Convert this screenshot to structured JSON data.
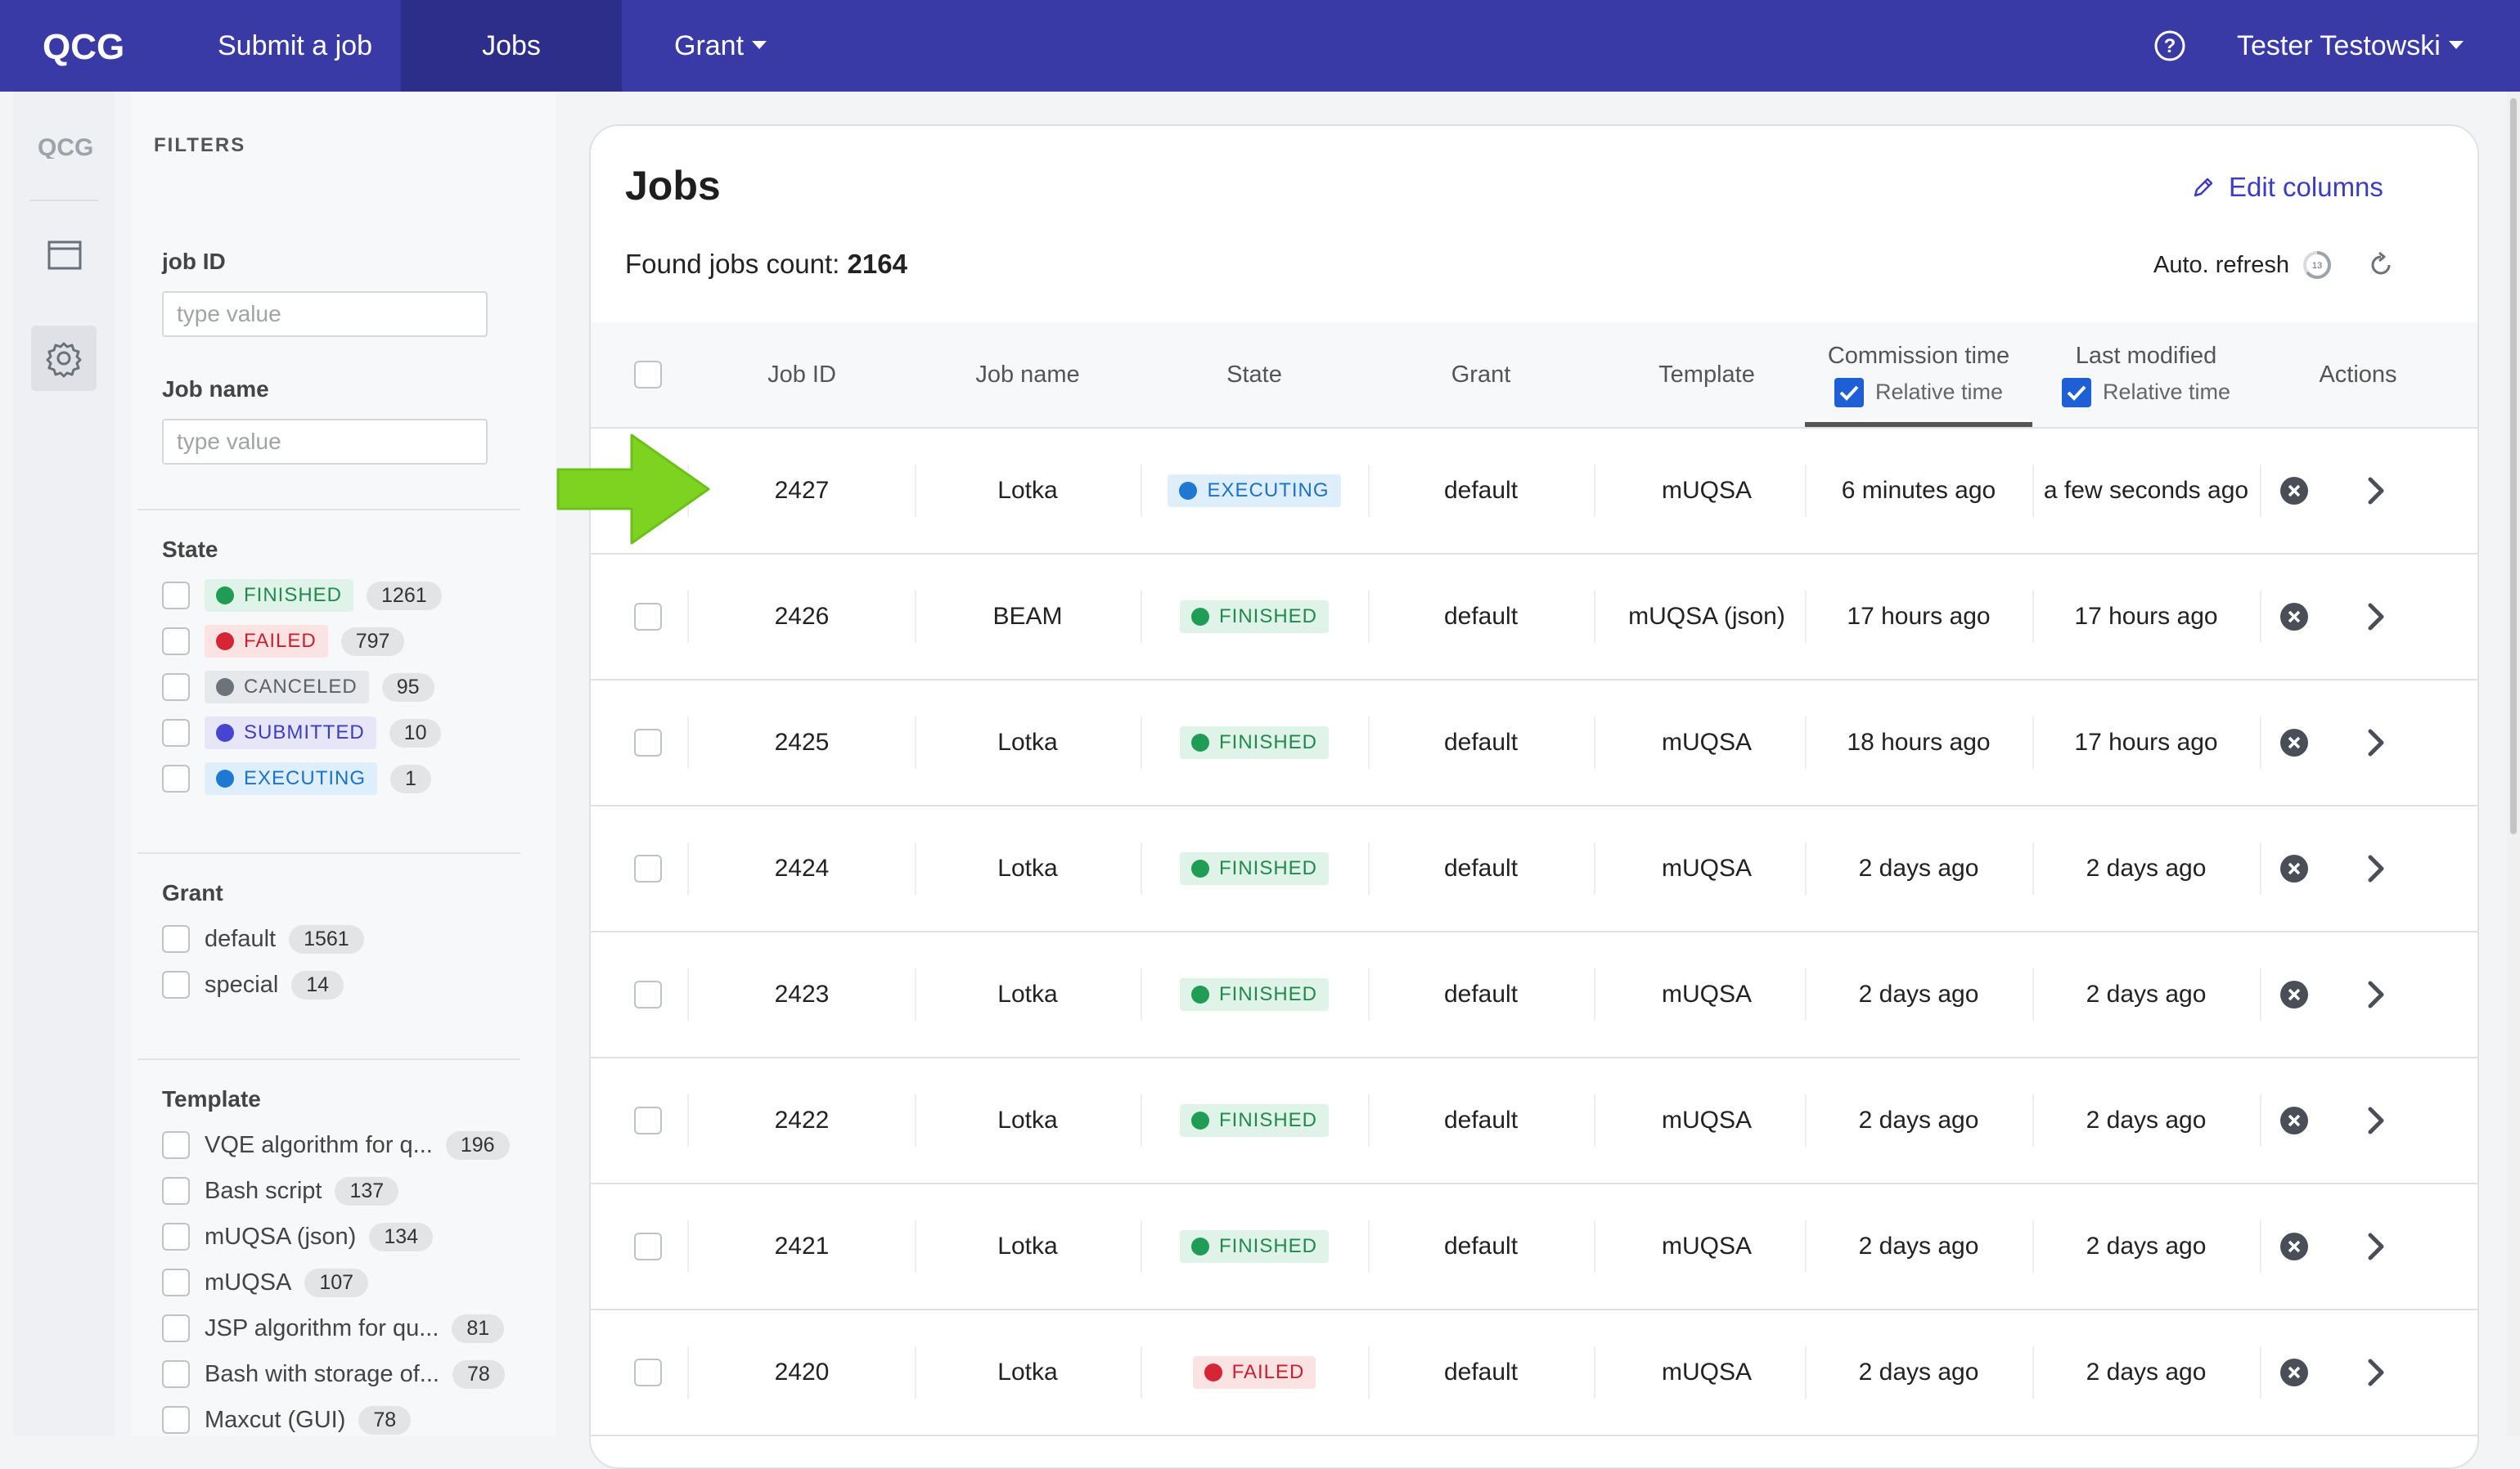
{
  "nav": {
    "logo": "QCG",
    "items": [
      "Submit a job",
      "Jobs",
      "Grant"
    ],
    "user": "Tester Testowski"
  },
  "rail": {
    "logo": "QCG",
    "icons": [
      "folder-icon",
      "gear-icon"
    ]
  },
  "filters": {
    "title": "FILTERS",
    "job_id": {
      "label": "job ID",
      "placeholder": "type value"
    },
    "job_name": {
      "label": "Job name",
      "placeholder": "type value"
    },
    "state": {
      "label": "State",
      "items": [
        {
          "label": "FINISHED",
          "count": "1261"
        },
        {
          "label": "FAILED",
          "count": "797"
        },
        {
          "label": "CANCELED",
          "count": "95"
        },
        {
          "label": "SUBMITTED",
          "count": "10"
        },
        {
          "label": "EXECUTING",
          "count": "1"
        }
      ]
    },
    "grant": {
      "label": "Grant",
      "items": [
        {
          "label": "default",
          "count": "1561"
        },
        {
          "label": "special",
          "count": "14"
        }
      ]
    },
    "template": {
      "label": "Template",
      "items": [
        {
          "label": "VQE algorithm for q...",
          "count": "196"
        },
        {
          "label": "Bash script",
          "count": "137"
        },
        {
          "label": "mUQSA (json)",
          "count": "134"
        },
        {
          "label": "mUQSA",
          "count": "107"
        },
        {
          "label": "JSP algorithm for qu...",
          "count": "81"
        },
        {
          "label": "Bash with storage of...",
          "count": "78"
        },
        {
          "label": "Maxcut (GUI)",
          "count": "78"
        }
      ]
    }
  },
  "main": {
    "title": "Jobs",
    "found_label": "Found jobs count:",
    "found_count": "2164",
    "edit_columns": "Edit columns",
    "auto_refresh": "Auto. refresh",
    "auto_refresh_seconds": "13",
    "columns": {
      "job_id": "Job ID",
      "job_name": "Job name",
      "state": "State",
      "grant": "Grant",
      "template": "Template",
      "commission": "Commission time",
      "last_modified": "Last modified",
      "relative": "Relative time",
      "actions": "Actions"
    },
    "rows": [
      {
        "id": "2427",
        "name": "Lotka",
        "state": "EXECUTING",
        "grant": "default",
        "template": "mUQSA",
        "commission": "6 minutes ago",
        "modified": "a few seconds ago"
      },
      {
        "id": "2426",
        "name": "BEAM",
        "state": "FINISHED",
        "grant": "default",
        "template": "mUQSA (json)",
        "commission": "17 hours ago",
        "modified": "17 hours ago"
      },
      {
        "id": "2425",
        "name": "Lotka",
        "state": "FINISHED",
        "grant": "default",
        "template": "mUQSA",
        "commission": "18 hours ago",
        "modified": "17 hours ago"
      },
      {
        "id": "2424",
        "name": "Lotka",
        "state": "FINISHED",
        "grant": "default",
        "template": "mUQSA",
        "commission": "2 days ago",
        "modified": "2 days ago"
      },
      {
        "id": "2423",
        "name": "Lotka",
        "state": "FINISHED",
        "grant": "default",
        "template": "mUQSA",
        "commission": "2 days ago",
        "modified": "2 days ago"
      },
      {
        "id": "2422",
        "name": "Lotka",
        "state": "FINISHED",
        "grant": "default",
        "template": "mUQSA",
        "commission": "2 days ago",
        "modified": "2 days ago"
      },
      {
        "id": "2421",
        "name": "Lotka",
        "state": "FINISHED",
        "grant": "default",
        "template": "mUQSA",
        "commission": "2 days ago",
        "modified": "2 days ago"
      },
      {
        "id": "2420",
        "name": "Lotka",
        "state": "FAILED",
        "grant": "default",
        "template": "mUQSA",
        "commission": "2 days ago",
        "modified": "2 days ago"
      }
    ]
  },
  "colors": {
    "nav": "#3a3aa6",
    "accent": "#3d3dc1",
    "highlight_arrow": "#7ed321"
  }
}
